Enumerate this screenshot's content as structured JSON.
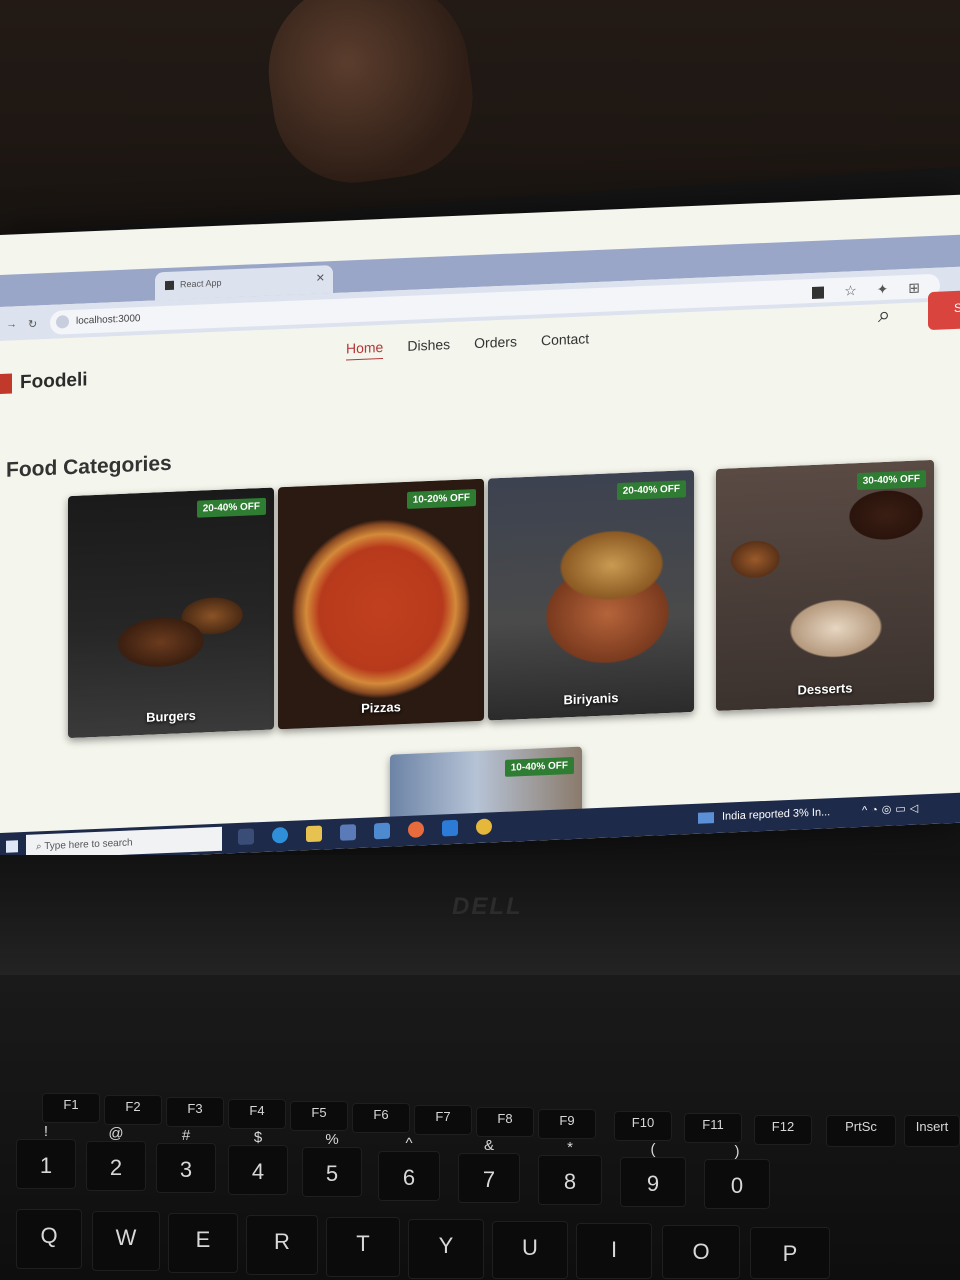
{
  "browser": {
    "tabs": [
      {
        "label": "",
        "active": false
      },
      {
        "label": "React App",
        "active": true
      }
    ],
    "url": "localhost:3000"
  },
  "site": {
    "brand": "Foodeli",
    "nav": [
      "Home",
      "Dishes",
      "Orders",
      "Contact"
    ],
    "active_nav": "Home",
    "signin_label": "S"
  },
  "section_title": "Food Categories",
  "categories": [
    {
      "name": "Burgers",
      "offer": "20-40% OFF"
    },
    {
      "name": "Pizzas",
      "offer": "10-20% OFF"
    },
    {
      "name": "Biriyanis",
      "offer": "20-40% OFF"
    },
    {
      "name": "Desserts",
      "offer": "30-40% OFF"
    },
    {
      "name": "",
      "offer": "10-40% OFF"
    }
  ],
  "taskbar": {
    "search_placeholder": "Type here to search",
    "news": "India reported 3% In..."
  },
  "laptop": {
    "brand": "DELL",
    "keys": {
      "fn_row": [
        "F1",
        "F2",
        "F3",
        "F4",
        "F5",
        "F6",
        "F7",
        "F8",
        "F9",
        "F10",
        "F11",
        "F12",
        "PrtSc",
        "Insert"
      ],
      "number_row": [
        "1",
        "2",
        "3",
        "4",
        "5",
        "6",
        "7",
        "8",
        "9",
        "0"
      ],
      "number_row_shift": [
        "!",
        "@",
        "#",
        "$",
        "%",
        "^",
        "&",
        "*",
        "(",
        ")"
      ],
      "letter_row": [
        "Q",
        "W",
        "E",
        "R",
        "T",
        "Y",
        "U",
        "I",
        "O",
        "P"
      ]
    }
  },
  "colors": {
    "accent_red": "#b23a3a",
    "badge_green": "#2e7d32",
    "page_bg": "#f4f5ec",
    "taskbar": "#1e2a4a"
  }
}
